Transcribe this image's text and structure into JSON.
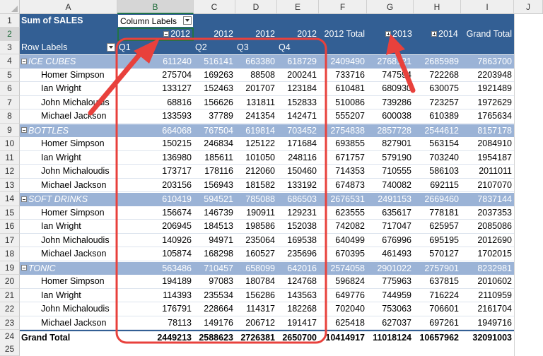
{
  "columns": [
    "A",
    "B",
    "C",
    "D",
    "E",
    "F",
    "G",
    "H",
    "I",
    "J"
  ],
  "header": {
    "title": "Sum of SALES",
    "column_labels": "Column Labels",
    "row_labels": "Row Labels",
    "year_2012": "2012",
    "year_2012_plain": "2012",
    "total_2012": "2012 Total",
    "year_2013": "2013",
    "year_2014": "2014",
    "grand_total": "Grand Total",
    "quarters": [
      "Q1",
      "Q2",
      "Q3",
      "Q4"
    ]
  },
  "rows": [
    {
      "num": "4",
      "type": "group",
      "label": "ICE CUBES",
      "vals": [
        "611240",
        "516141",
        "663380",
        "618729",
        "2409490",
        "2768121",
        "2685989",
        "7863700"
      ]
    },
    {
      "num": "5",
      "type": "item",
      "label": "Homer Simpson",
      "vals": [
        "275704",
        "169263",
        "88508",
        "200241",
        "733716",
        "747594",
        "722268",
        "2203948"
      ]
    },
    {
      "num": "6",
      "type": "item",
      "label": "Ian Wright",
      "vals": [
        "133127",
        "152463",
        "201707",
        "123184",
        "610481",
        "680930",
        "630075",
        "1921489"
      ]
    },
    {
      "num": "7",
      "type": "item",
      "label": "John Michaloudis",
      "vals": [
        "68816",
        "156626",
        "131811",
        "152833",
        "510086",
        "739286",
        "723257",
        "1972629"
      ]
    },
    {
      "num": "8",
      "type": "item",
      "label": "Michael Jackson",
      "vals": [
        "133593",
        "37789",
        "241354",
        "142471",
        "555207",
        "600038",
        "610389",
        "1765634"
      ]
    },
    {
      "num": "9",
      "type": "group",
      "label": "BOTTLES",
      "vals": [
        "664068",
        "767504",
        "619814",
        "703452",
        "2754838",
        "2857728",
        "2544612",
        "8157178"
      ]
    },
    {
      "num": "10",
      "type": "item",
      "label": "Homer Simpson",
      "vals": [
        "150215",
        "246834",
        "125122",
        "171684",
        "693855",
        "827901",
        "563154",
        "2084910"
      ]
    },
    {
      "num": "11",
      "type": "item",
      "label": "Ian Wright",
      "vals": [
        "136980",
        "185611",
        "101050",
        "248116",
        "671757",
        "579190",
        "703240",
        "1954187"
      ]
    },
    {
      "num": "12",
      "type": "item",
      "label": "John Michaloudis",
      "vals": [
        "173717",
        "178116",
        "212060",
        "150460",
        "714353",
        "710555",
        "586103",
        "2011011"
      ]
    },
    {
      "num": "13",
      "type": "item",
      "label": "Michael Jackson",
      "vals": [
        "203156",
        "156943",
        "181582",
        "133192",
        "674873",
        "740082",
        "692115",
        "2107070"
      ]
    },
    {
      "num": "14",
      "type": "group",
      "label": "SOFT DRINKS",
      "vals": [
        "610419",
        "594521",
        "785088",
        "686503",
        "2676531",
        "2491153",
        "2669460",
        "7837144"
      ]
    },
    {
      "num": "15",
      "type": "item",
      "label": "Homer Simpson",
      "vals": [
        "156674",
        "146739",
        "190911",
        "129231",
        "623555",
        "635617",
        "778181",
        "2037353"
      ]
    },
    {
      "num": "16",
      "type": "item",
      "label": "Ian Wright",
      "vals": [
        "206945",
        "184513",
        "198586",
        "152038",
        "742082",
        "717047",
        "625957",
        "2085086"
      ]
    },
    {
      "num": "17",
      "type": "item",
      "label": "John Michaloudis",
      "vals": [
        "140926",
        "94971",
        "235064",
        "169538",
        "640499",
        "676996",
        "695195",
        "2012690"
      ]
    },
    {
      "num": "18",
      "type": "item",
      "label": "Michael Jackson",
      "vals": [
        "105874",
        "168298",
        "160527",
        "235696",
        "670395",
        "461493",
        "570127",
        "1702015"
      ]
    },
    {
      "num": "19",
      "type": "group",
      "label": "TONIC",
      "vals": [
        "563486",
        "710457",
        "658099",
        "642016",
        "2574058",
        "2901022",
        "2757901",
        "8232981"
      ]
    },
    {
      "num": "20",
      "type": "item",
      "label": "Homer Simpson",
      "vals": [
        "194189",
        "97083",
        "180784",
        "124768",
        "596824",
        "775963",
        "637815",
        "2010602"
      ]
    },
    {
      "num": "21",
      "type": "item",
      "label": "Ian Wright",
      "vals": [
        "114393",
        "235534",
        "156286",
        "143563",
        "649776",
        "744959",
        "716224",
        "2110959"
      ]
    },
    {
      "num": "22",
      "type": "item",
      "label": "John Michaloudis",
      "vals": [
        "176791",
        "228664",
        "114317",
        "182268",
        "702040",
        "753063",
        "706601",
        "2161704"
      ]
    },
    {
      "num": "23",
      "type": "item",
      "label": "Michael Jackson",
      "vals": [
        "78113",
        "149176",
        "206712",
        "191417",
        "625418",
        "627037",
        "697261",
        "1949716"
      ]
    },
    {
      "num": "24",
      "type": "total",
      "label": "Grand Total",
      "vals": [
        "2449213",
        "2588623",
        "2726381",
        "2650700",
        "10414917",
        "11018124",
        "10657962",
        "32091003"
      ]
    }
  ],
  "row_numbers_top": [
    "1",
    "2",
    "3"
  ],
  "extra_row_number": "25",
  "colors": {
    "header_blue": "#335f94",
    "group_blue": "#9bb3d6",
    "highlight_red": "#e8413c"
  }
}
